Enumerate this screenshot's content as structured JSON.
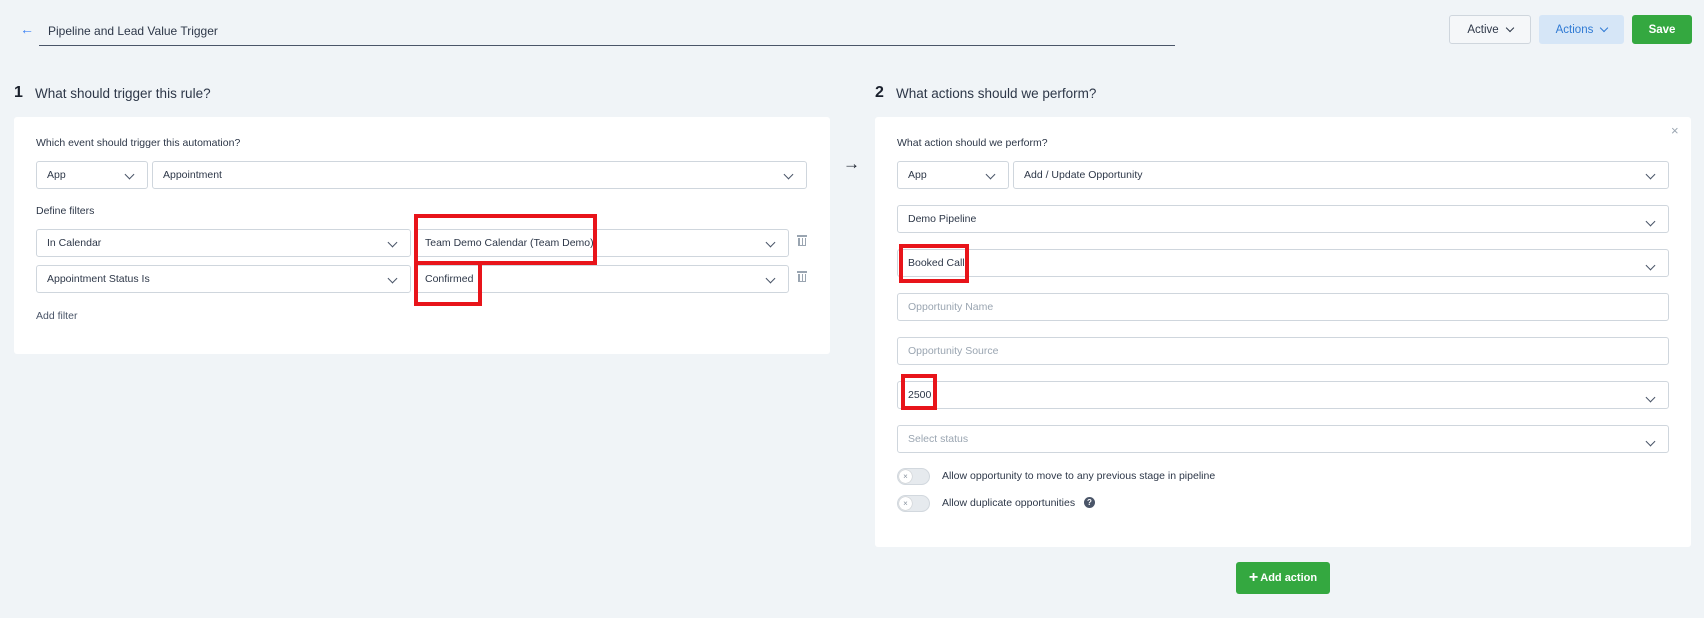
{
  "header": {
    "back_icon": "arrow-left-icon",
    "title": "Pipeline and Lead Value Trigger",
    "status_button": "Active",
    "actions_button": "Actions",
    "save_button": "Save"
  },
  "trigger": {
    "number": "1",
    "heading": "What should trigger this rule?",
    "event_label": "Which event should trigger this automation?",
    "event_source": "App",
    "event_type": "Appointment",
    "filters_label": "Define filters",
    "filters": [
      {
        "field": "In Calendar",
        "value": "Team Demo Calendar (Team Demo)"
      },
      {
        "field": "Appointment Status Is",
        "value": "Confirmed"
      }
    ],
    "add_filter": "Add filter"
  },
  "flow_icon": "arrow-right-icon",
  "action": {
    "number": "2",
    "heading": "What actions should we perform?",
    "action_label": "What action should we perform?",
    "action_source": "App",
    "action_type": "Add / Update Opportunity",
    "pipeline": "Demo Pipeline",
    "stage": "Booked Call",
    "opportunity_name_placeholder": "Opportunity Name",
    "opportunity_source_placeholder": "Opportunity Source",
    "lead_value": "2500",
    "status_placeholder": "Select status",
    "toggle_previous_stage": "Allow opportunity to move to any previous stage in pipeline",
    "toggle_duplicates": "Allow duplicate opportunities",
    "add_action": "Add action"
  },
  "colors": {
    "primary_green": "#34a840",
    "highlight_red": "#e8141a",
    "link_blue": "#3b82f6"
  }
}
